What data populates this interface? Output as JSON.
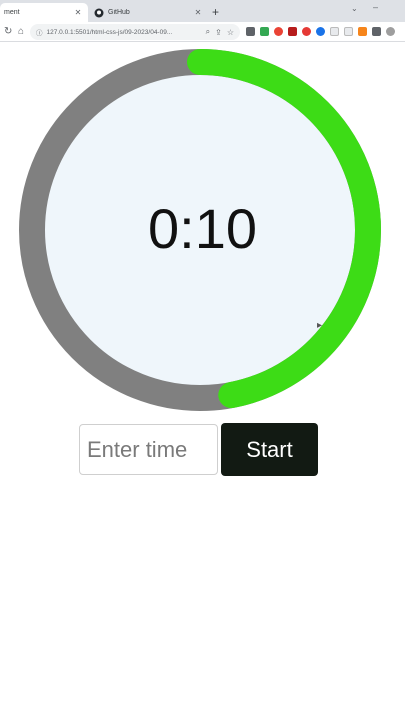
{
  "browser": {
    "tabs": [
      {
        "label": "ment",
        "active": true
      },
      {
        "label": "GitHub",
        "active": false
      }
    ],
    "new_tab": "+",
    "url": "127.0.0.1:5501/html-css-js/09-2023/04-09...",
    "colors": {
      "tabstrip": "#dee1e6",
      "omnibox": "#f1f3f4"
    }
  },
  "timer": {
    "display": "0:10",
    "progress": 0.47,
    "colors": {
      "progress": "#3ddc16",
      "track": "#808080",
      "face": "#eff6fb"
    }
  },
  "controls": {
    "input_placeholder": "Enter time",
    "input_value": "",
    "start_label": "Start"
  }
}
